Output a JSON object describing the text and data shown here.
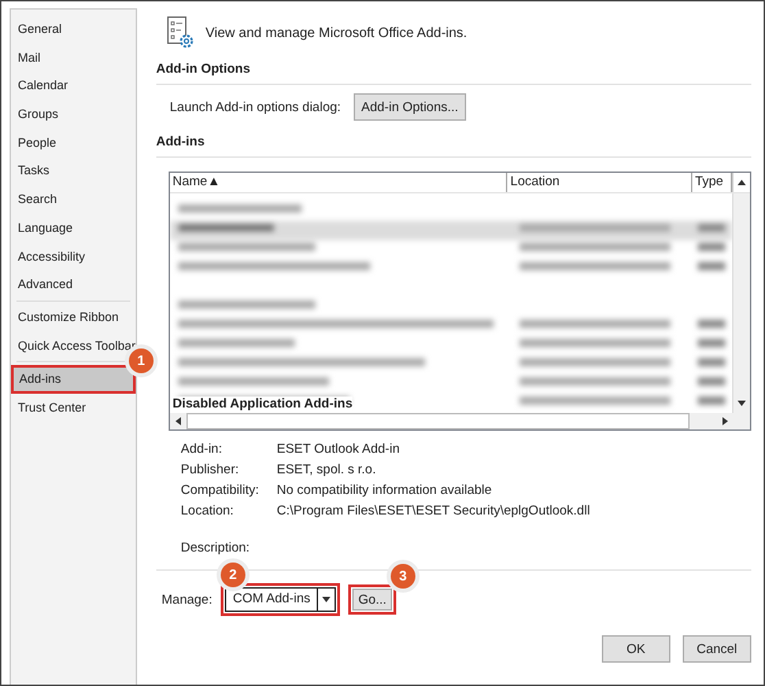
{
  "sidebar": {
    "sections": [
      [
        {
          "label": "General",
          "selected": false
        },
        {
          "label": "Mail",
          "selected": false
        },
        {
          "label": "Calendar",
          "selected": false
        },
        {
          "label": "Groups",
          "selected": false
        },
        {
          "label": "People",
          "selected": false
        },
        {
          "label": "Tasks",
          "selected": false
        },
        {
          "label": "Search",
          "selected": false
        },
        {
          "label": "Language",
          "selected": false
        },
        {
          "label": "Accessibility",
          "selected": false
        },
        {
          "label": "Advanced",
          "selected": false
        }
      ],
      [
        {
          "label": "Customize Ribbon",
          "selected": false
        },
        {
          "label": "Quick Access Toolbar",
          "selected": false
        }
      ],
      [
        {
          "label": "Add-ins",
          "selected": true,
          "callout": "1"
        },
        {
          "label": "Trust Center",
          "selected": false
        }
      ]
    ]
  },
  "header": {
    "title": "View and manage Microsoft Office Add-ins."
  },
  "addin_options": {
    "heading": "Add-in Options",
    "label": "Launch Add-in options dialog:",
    "button": "Add-in Options..."
  },
  "addins": {
    "heading": "Add-ins",
    "columns": [
      {
        "label": "Name",
        "sort": "▲"
      },
      {
        "label": "Location"
      },
      {
        "label": "Type"
      }
    ],
    "group_label": "Disabled Application Add-ins"
  },
  "details": [
    {
      "label": "Add-in:",
      "value": "ESET Outlook Add-in"
    },
    {
      "label": "Publisher:",
      "value": "ESET, spol. s r.o."
    },
    {
      "label": "Compatibility:",
      "value": "No compatibility information available"
    },
    {
      "label": "Location:",
      "value": "C:\\Program Files\\ESET\\ESET Security\\eplgOutlook.dll"
    },
    {
      "label": "Description:"
    }
  ],
  "manage": {
    "label": "Manage:",
    "value": "COM Add-ins",
    "callout": "2",
    "go_button": "Go...",
    "go_callout": "3"
  },
  "buttons": [
    "OK",
    "Cancel"
  ]
}
